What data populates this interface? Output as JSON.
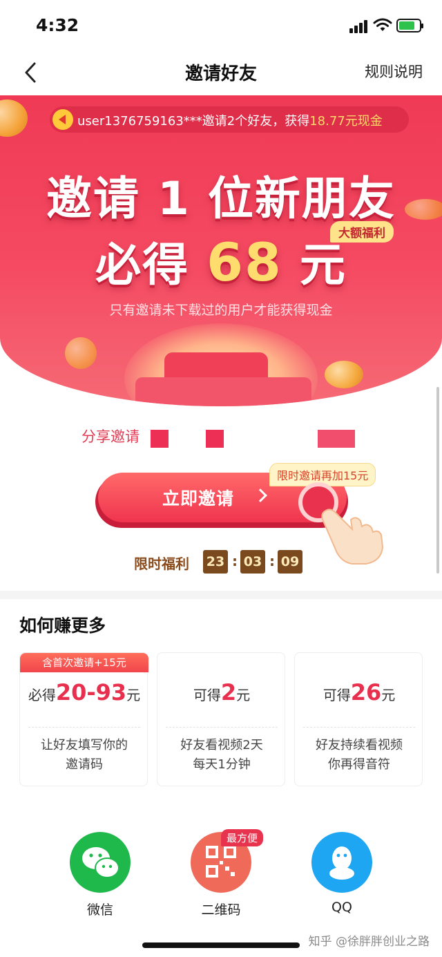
{
  "status_bar": {
    "time": "4:32"
  },
  "nav": {
    "title": "邀请好友",
    "rules_label": "规则说明"
  },
  "ticker": {
    "text_prefix": "user1376759163***邀请2个好友，获得",
    "text_highlight": "18.77元现金"
  },
  "hero": {
    "line1": "邀请 1 位新朋友",
    "line2_prefix": "必得",
    "line2_amount": "68",
    "line2_suffix": "元",
    "badge": "大额福利",
    "note": "只有邀请未下载过的用户才能获得现金"
  },
  "share": {
    "label": "分享邀请"
  },
  "invite": {
    "button_label": "立即邀请",
    "limited_tag": "限时邀请再加15元"
  },
  "countdown": {
    "label": "限时福利",
    "hours": "23",
    "minutes": "03",
    "seconds": "09",
    "separator": ":"
  },
  "earn": {
    "title": "如何赚更多",
    "cards": [
      {
        "tag": "含首次邀请+15元",
        "prefix": "必得",
        "amount": "20-93",
        "suffix": "元",
        "desc1": "让好友填写你的",
        "desc2": "邀请码"
      },
      {
        "tag": "",
        "prefix": "可得",
        "amount": "2",
        "suffix": "元",
        "desc1": "好友看视频2天",
        "desc2": "每天1分钟"
      },
      {
        "tag": "",
        "prefix": "可得",
        "amount": "26",
        "suffix": "元",
        "desc1": "好友持续看视频",
        "desc2": "你再得音符"
      }
    ]
  },
  "methods": [
    {
      "label": "微信",
      "icon": "wechat-icon",
      "color": "#1fb84b"
    },
    {
      "label": "二维码",
      "icon": "qrcode-icon",
      "color": "#f06a5a",
      "badge": "最方便"
    },
    {
      "label": "QQ",
      "icon": "qq-icon",
      "color": "#1ea6f2"
    }
  ],
  "watermark": "知乎 @徐胖胖创业之路",
  "colors": {
    "primary": "#f03a55",
    "gold": "#ffdc6e",
    "countdown_bg": "#7a4a1e"
  }
}
